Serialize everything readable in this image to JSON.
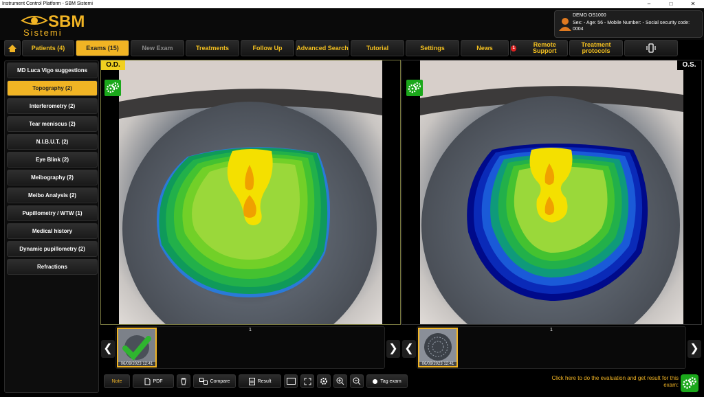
{
  "window": {
    "title": "Instrument Control Platform - SBM Sistemi",
    "min": "–",
    "max": "□",
    "close": "✕"
  },
  "logo": {
    "brand": "SBM",
    "sub": "Sistemi"
  },
  "patient": {
    "name": "DEMO OS1000",
    "info": "Sex:  - Age: 56 - Mobile Number:  - Social security code: 0004"
  },
  "nav": {
    "home_icon": "home-icon",
    "items": [
      {
        "label": "Patients (4)"
      },
      {
        "label": "Exams (15)"
      },
      {
        "label": "New Exam"
      },
      {
        "label": "Treatments"
      },
      {
        "label": "Follow Up"
      },
      {
        "label": "Advanced Search"
      },
      {
        "label": "Tutorial"
      },
      {
        "label": "Settings"
      },
      {
        "label": "News"
      },
      {
        "label": "Remote Support",
        "badge": "1"
      },
      {
        "label": "Treatment protocols"
      },
      {
        "label": "",
        "icon": "phone-vibrate-icon"
      }
    ]
  },
  "sidebar": {
    "items": [
      {
        "label": "MD Luca Vigo suggestions"
      },
      {
        "label": "Topography (2)"
      },
      {
        "label": "Interferometry (2)"
      },
      {
        "label": "Tear meniscus (2)"
      },
      {
        "label": "N.I.B.U.T. (2)"
      },
      {
        "label": "Eye Blink (2)"
      },
      {
        "label": "Meibography (2)"
      },
      {
        "label": "Meibo Analysis (2)"
      },
      {
        "label": "Pupillometry / WTW (1)"
      },
      {
        "label": "Medical history"
      },
      {
        "label": "Dynamic pupillometry (2)"
      },
      {
        "label": "Refractions"
      }
    ]
  },
  "od": {
    "label": "O.D.",
    "page": "1",
    "thumb_date": "06/09/2023 12:41"
  },
  "os": {
    "label": "O.S.",
    "page": "1",
    "thumb_date": "06/09/2023 12:41"
  },
  "toolbar": {
    "note": "Note",
    "pdf": "PDF",
    "compare": "Compare",
    "result": "Result",
    "tag": "Tag exam"
  },
  "cta": "Click here to do the evaluation and get result for this exam:",
  "colors": {
    "accent": "#f1b424",
    "green": "#1ba81b"
  }
}
